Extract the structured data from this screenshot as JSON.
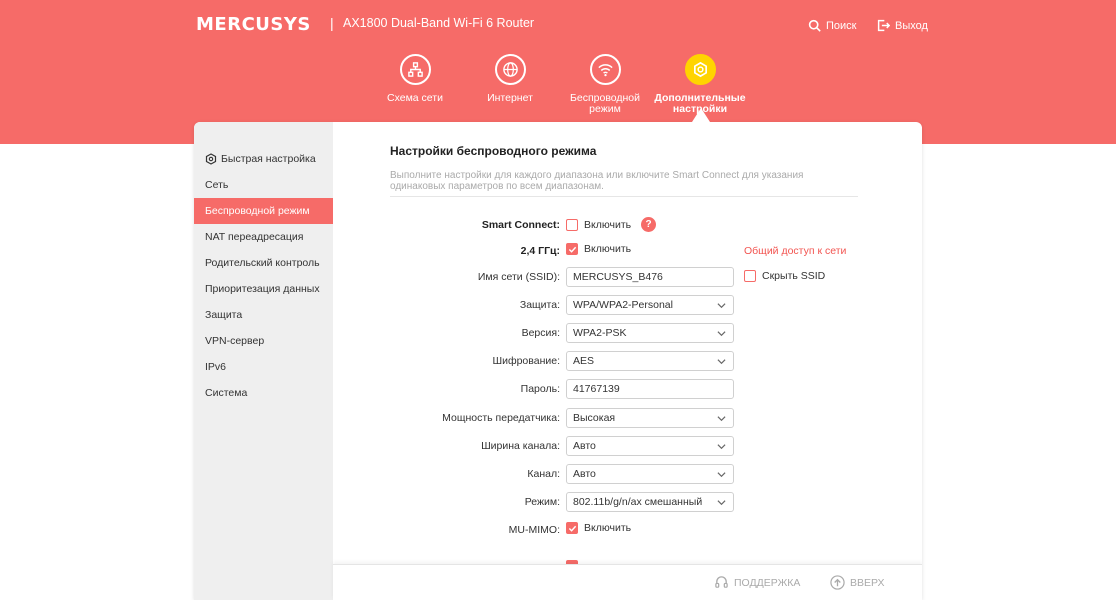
{
  "header": {
    "logo": "MERCUSYS",
    "separator": "|",
    "model": "AX1800 Dual-Band Wi-Fi 6 Router",
    "search_label": "Поиск",
    "logout_label": "Выход",
    "accent_color": "#f66b68",
    "active_color": "#ffd400"
  },
  "nav": {
    "items": [
      {
        "label": "Схема сети",
        "icon": "network-map-icon"
      },
      {
        "label": "Интернет",
        "icon": "globe-icon"
      },
      {
        "label": "Беспроводной режим",
        "icon": "wifi-icon"
      },
      {
        "label": "Дополнительные настройки",
        "icon": "gear-icon",
        "active": true
      }
    ]
  },
  "sidebar": {
    "items": [
      {
        "label": "Быстрая настройка",
        "icon": "gear-icon"
      },
      {
        "label": "Сеть"
      },
      {
        "label": "Беспроводной режим",
        "active": true
      },
      {
        "label": "NAT переадресация"
      },
      {
        "label": "Родительский контроль"
      },
      {
        "label": "Приоритезация данных"
      },
      {
        "label": "Защита"
      },
      {
        "label": "VPN-сервер"
      },
      {
        "label": "IPv6"
      },
      {
        "label": "Система"
      }
    ]
  },
  "main": {
    "title": "Настройки беспроводного режима",
    "description": "Выполните настройки для каждого диапазона или включите Smart Connect для указания одинаковых параметров по всем диапазонам.",
    "smart_connect": {
      "label": "Smart Connect:",
      "checkbox_label": "Включить",
      "checked": false,
      "help": "?"
    },
    "band24": {
      "label": "2,4 ГГц:",
      "checkbox_label": "Включить",
      "checked": true,
      "share_link": "Общий доступ к сети"
    },
    "ssid": {
      "label": "Имя сети (SSID):",
      "value": "MERCUSYS_B476",
      "hide_label": "Скрыть SSID",
      "hide_checked": false
    },
    "security": {
      "label": "Защита:",
      "value": "WPA/WPA2-Personal"
    },
    "version": {
      "label": "Версия:",
      "value": "WPA2-PSK"
    },
    "encryption": {
      "label": "Шифрование:",
      "value": "AES"
    },
    "password": {
      "label": "Пароль:",
      "value": "41767139"
    },
    "tx_power": {
      "label": "Мощность передатчика:",
      "value": "Высокая"
    },
    "channel_width": {
      "label": "Ширина канала:",
      "value": "Авто"
    },
    "channel": {
      "label": "Канал:",
      "value": "Авто"
    },
    "mode": {
      "label": "Режим:",
      "value": "802.11b/g/n/ax смешанный"
    },
    "mu_mimo": {
      "label": "MU-MIMO:",
      "checkbox_label": "Включить",
      "checked": true
    }
  },
  "footer": {
    "support_label": "ПОДДЕРЖКА",
    "top_label": "ВВЕРХ"
  }
}
